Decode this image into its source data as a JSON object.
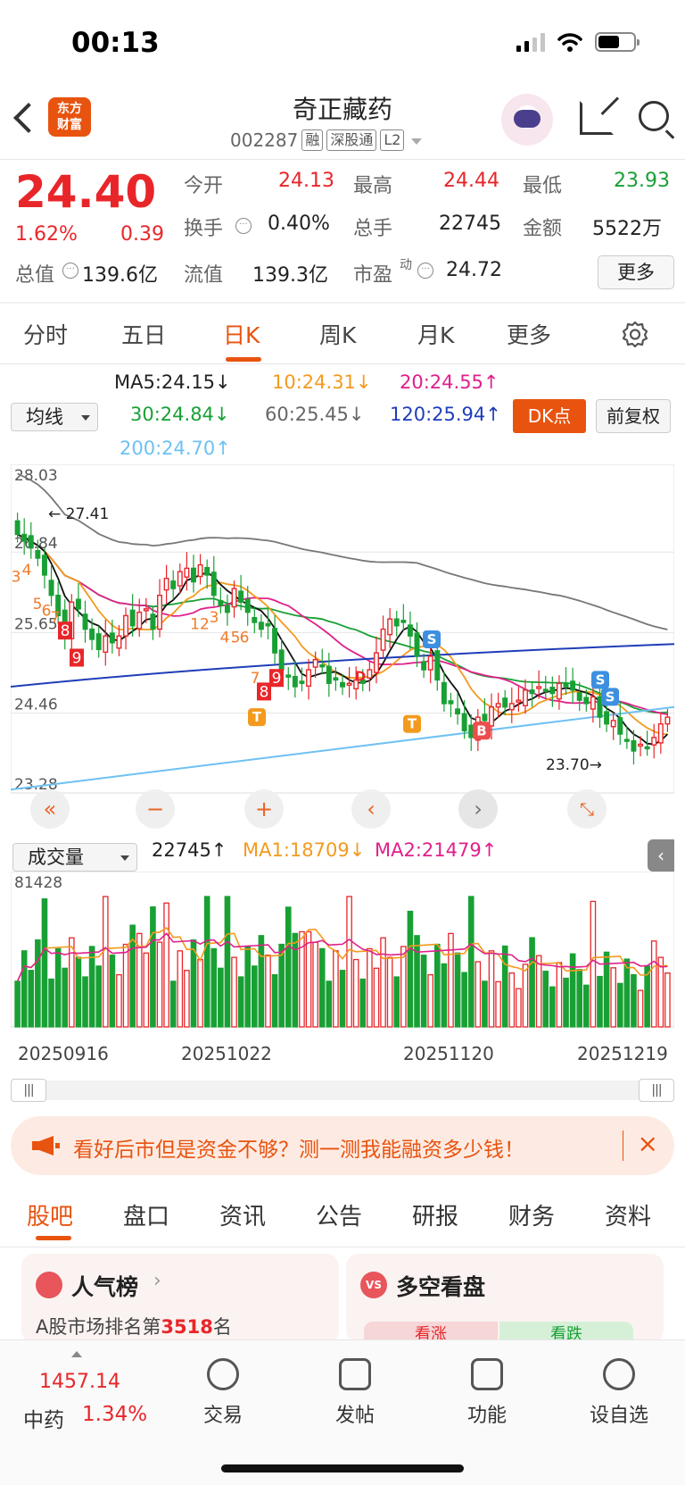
{
  "status": {
    "time": "00:13"
  },
  "header": {
    "back_icon": "chevron-left-icon",
    "logo_text": "东方\n财富",
    "name": "奇正藏药",
    "code": "002287",
    "tags": [
      "融",
      "深股通",
      "L2"
    ]
  },
  "quote": {
    "price": "24.40",
    "pct": "1.62%",
    "change": "0.39",
    "items": [
      {
        "label": "今开",
        "value": "24.13",
        "color": "#e8262a"
      },
      {
        "label": "最高",
        "value": "24.44",
        "color": "#e8262a"
      },
      {
        "label": "最低",
        "value": "23.93",
        "color": "#19a035"
      },
      {
        "label": "换手",
        "value": "0.40%",
        "color": "#222"
      },
      {
        "label": "总手",
        "value": "22745",
        "color": "#222"
      },
      {
        "label": "金额",
        "value": "5522万",
        "color": "#222"
      },
      {
        "label": "总值",
        "value": "139.6亿",
        "color": "#222"
      },
      {
        "label": "流值",
        "value": "139.3亿",
        "color": "#222"
      },
      {
        "label": "市盈",
        "sup": "动",
        "value": "24.72",
        "color": "#222"
      }
    ],
    "more": "更多"
  },
  "tabs": [
    "分时",
    "五日",
    "日K",
    "周K",
    "月K",
    "更多"
  ],
  "ma": {
    "select": "均线",
    "ma5": "MA5:24.15↓",
    "ma10": "10:24.31↓",
    "ma20": "20:24.55↑",
    "ma30": "30:24.84↓",
    "ma60": "60:25.45↓",
    "ma120": "120:25.94↑",
    "ma200": "200:24.70↑",
    "dk": "DK点",
    "fq": "前复权"
  },
  "chart_data": {
    "type": "candlestick",
    "ylim": [
      23.28,
      28.03
    ],
    "yticks": [
      "28.03",
      "26.84",
      "25.65",
      "24.46",
      "23.28"
    ],
    "high_label": "27.41",
    "low_label": "23.70",
    "closes": [
      27.1,
      27.0,
      26.9,
      26.75,
      26.5,
      26.2,
      25.9,
      25.6,
      26.1,
      26.0,
      25.7,
      25.55,
      25.4,
      25.6,
      25.5,
      25.6,
      25.9,
      25.75,
      25.95,
      26.0,
      25.7,
      26.2,
      26.45,
      26.3,
      26.55,
      26.6,
      26.4,
      26.65,
      26.5,
      26.2,
      26.05,
      25.95,
      26.3,
      26.1,
      25.95,
      25.8,
      25.7,
      25.75,
      25.35,
      25.1,
      25.0,
      24.85,
      24.9,
      25.1,
      25.25,
      25.15,
      24.9,
      24.95,
      24.85,
      24.9,
      24.95,
      24.9,
      25.1,
      25.35,
      25.7,
      25.85,
      25.75,
      25.8,
      25.6,
      25.3,
      25.1,
      25.3,
      24.95,
      24.6,
      24.6,
      24.45,
      24.2,
      24.1,
      24.4,
      24.35,
      24.55,
      24.6,
      24.55,
      24.6,
      24.65,
      24.8,
      24.75,
      24.85,
      24.8,
      24.75,
      24.9,
      24.85,
      24.8,
      24.65,
      24.6,
      24.7,
      24.4,
      24.3,
      24.35,
      24.15,
      24.05,
      23.9,
      24.0,
      23.95,
      24.1,
      24.3,
      24.4
    ],
    "volume": {
      "max": "81428",
      "ma1": "MA1:18709↓",
      "ma2": "MA2:21479↑",
      "current": "22745↑"
    },
    "dates": [
      "20250916",
      "20251022",
      "20251120",
      "20251219"
    ],
    "markers": [
      {
        "text": "T",
        "color": "#f39a1e"
      },
      {
        "text": "T",
        "color": "#f39a1e"
      },
      {
        "text": "B",
        "color": "#ec4d4d"
      },
      {
        "text": "S",
        "color": "#3d8fe0"
      },
      {
        "text": "S",
        "color": "#3d8fe0"
      },
      {
        "text": "S",
        "color": "#3d8fe0"
      },
      {
        "text": "D",
        "color": "#e8262a"
      }
    ],
    "td_counts": [
      "3",
      "4",
      "5",
      "6",
      "7",
      "8",
      "9",
      "12",
      "3",
      "4",
      "5",
      "6",
      "7",
      "8",
      "9"
    ]
  },
  "volume": {
    "select": "成交量"
  },
  "banner": {
    "text": "看好后市但是资金不够？测一测我能融资多少钱！"
  },
  "bottom_tabs": [
    "股吧",
    "盘口",
    "资讯",
    "公告",
    "研报",
    "财务",
    "资料"
  ],
  "cards": {
    "left": {
      "title": "人气榜",
      "prefix": "A股市场排名第",
      "rank": "3518",
      "suffix": "名"
    },
    "right": {
      "title": "多空看盘",
      "bull": "看涨",
      "bear": "看跌"
    }
  },
  "tabbar": {
    "index_value": "1457.14",
    "index_name": "中药",
    "index_pct": "1.34%",
    "items": [
      "交易",
      "发帖",
      "功能",
      "设自选"
    ]
  }
}
